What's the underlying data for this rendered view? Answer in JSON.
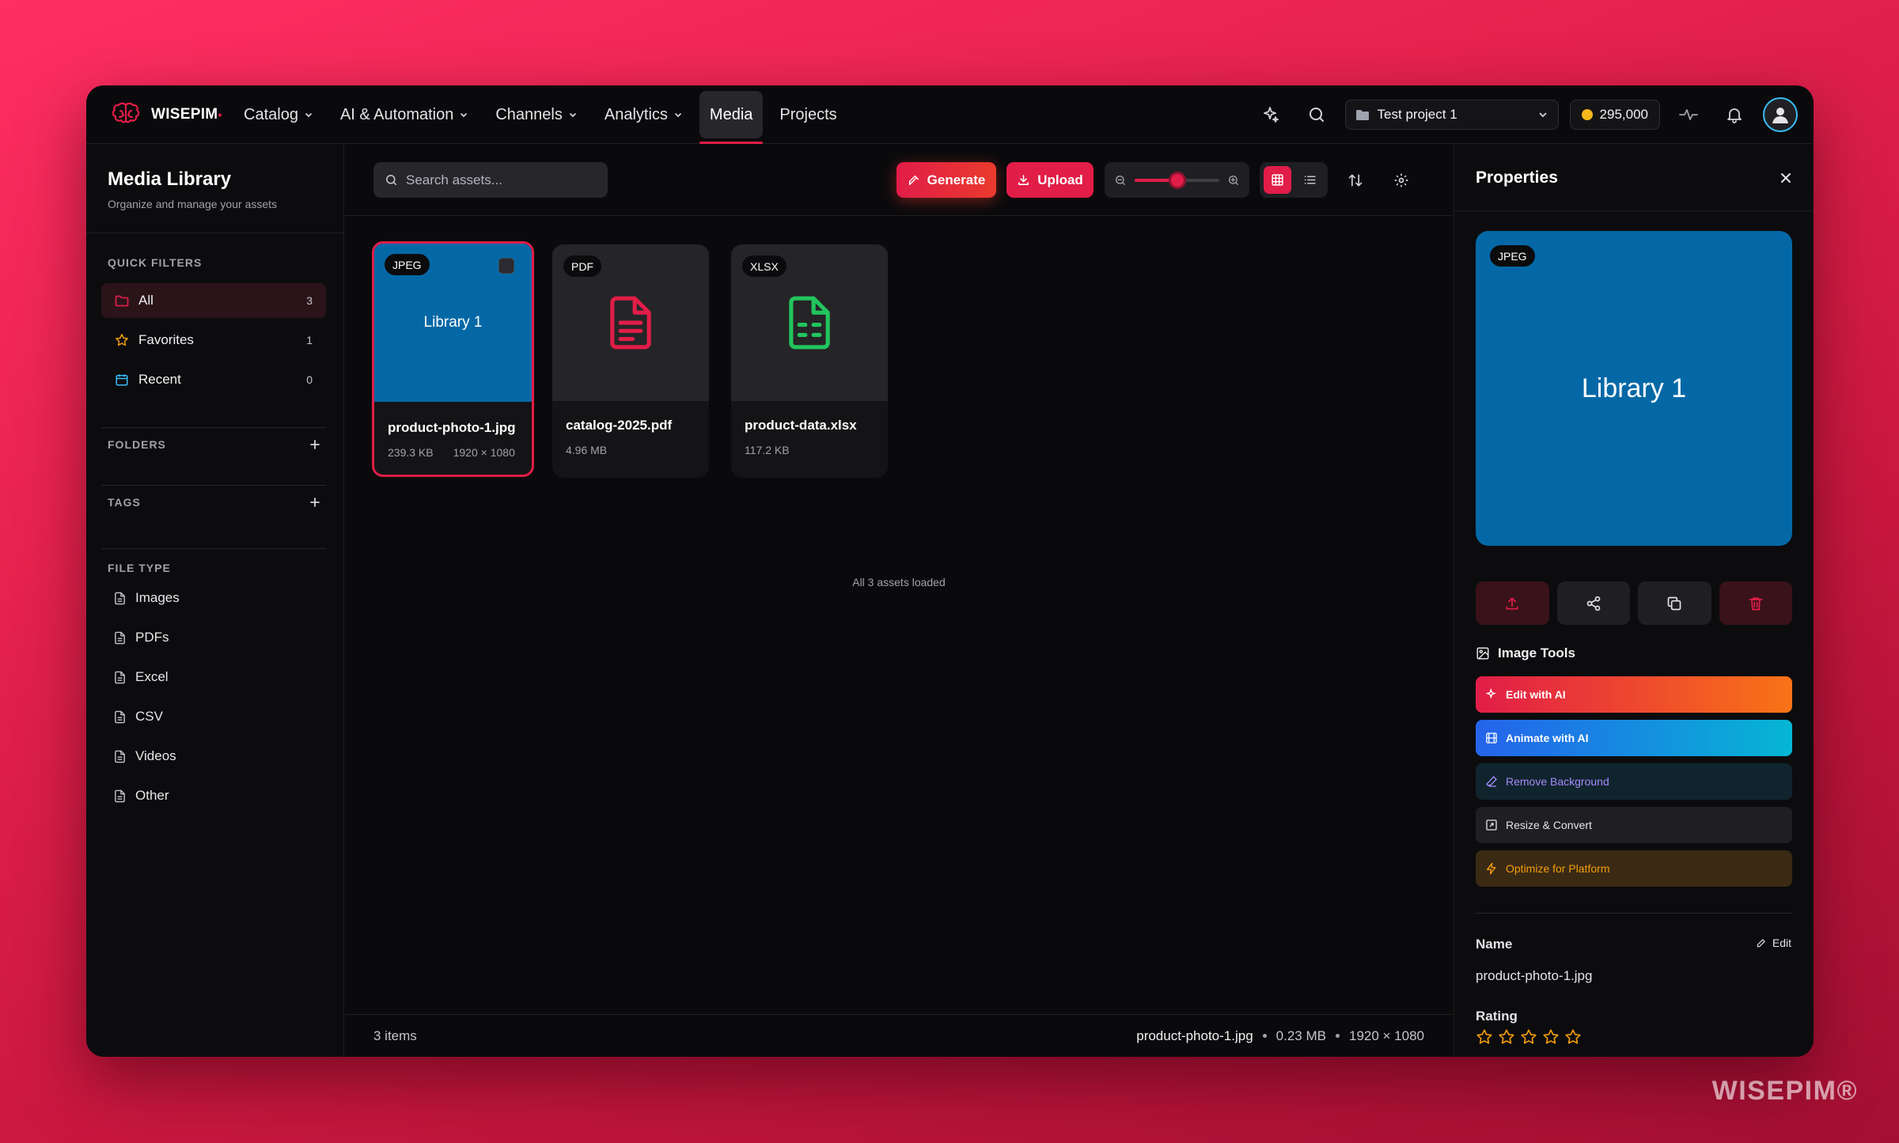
{
  "app": {
    "logo_text": "WISEPIM",
    "logo_mark": "•",
    "watermark": "WISEPIM®"
  },
  "nav": {
    "items": [
      {
        "label": "Catalog",
        "has_dropdown": true
      },
      {
        "label": "AI & Automation",
        "has_dropdown": true
      },
      {
        "label": "Channels",
        "has_dropdown": true
      },
      {
        "label": "Analytics",
        "has_dropdown": true
      },
      {
        "label": "Media",
        "active": true
      },
      {
        "label": "Projects"
      }
    ]
  },
  "topbar": {
    "project": "Test project 1",
    "credits": "295,000",
    "icons": [
      "sparkles-icon",
      "search-icon",
      "activity-icon",
      "bell-icon",
      "user-avatar"
    ]
  },
  "sidebar": {
    "title": "Media Library",
    "subtitle": "Organize and manage your assets",
    "quick_filters_label": "QUICK FILTERS",
    "quick_filters": [
      {
        "label": "All",
        "count": "3",
        "icon": "folder-icon",
        "active": true
      },
      {
        "label": "Favorites",
        "count": "1",
        "icon": "star-icon"
      },
      {
        "label": "Recent",
        "count": "0",
        "icon": "calendar-icon"
      }
    ],
    "folders_label": "FOLDERS",
    "tags_label": "TAGS",
    "file_type_label": "FILE TYPE",
    "file_types": [
      {
        "label": "Images"
      },
      {
        "label": "PDFs"
      },
      {
        "label": "Excel"
      },
      {
        "label": "CSV"
      },
      {
        "label": "Videos"
      },
      {
        "label": "Other"
      }
    ]
  },
  "toolbar": {
    "search_placeholder": "Search assets...",
    "generate_label": "Generate",
    "upload_label": "Upload",
    "zoom_level": 0.5,
    "view_mode": "grid"
  },
  "assets": [
    {
      "type_badge": "JPEG",
      "name": "product-photo-1.jpg",
      "size": "239.3 KB",
      "dimensions": "1920 × 1080",
      "thumb_text": "Library 1",
      "thumb_color": "#0568a6",
      "selected": true
    },
    {
      "type_badge": "PDF",
      "name": "catalog-2025.pdf",
      "size": "4.96 MB",
      "icon": "pdf-file-icon",
      "icon_color": "#e11d48"
    },
    {
      "type_badge": "XLSX",
      "name": "product-data.xlsx",
      "size": "117.2 KB",
      "icon": "spreadsheet-file-icon",
      "icon_color": "#22c55e"
    }
  ],
  "loaded_text": "All 3 assets loaded",
  "statusbar": {
    "count": "3 items",
    "selected_name": "product-photo-1.jpg",
    "selected_size": "0.23 MB",
    "selected_dims": "1920 × 1080"
  },
  "properties": {
    "title": "Properties",
    "preview_badge": "JPEG",
    "preview_text": "Library 1",
    "tools_label": "Image Tools",
    "tools": [
      {
        "label": "Edit with AI",
        "color": "#ffffff"
      },
      {
        "label": "Animate with AI",
        "color": "#ffffff"
      },
      {
        "label": "Remove Background",
        "color": "#a78bfa"
      },
      {
        "label": "Resize & Convert",
        "color": "#e4e4e7"
      },
      {
        "label": "Optimize for Platform",
        "color": "#f59e0b"
      }
    ],
    "name_label": "Name",
    "edit_label": "Edit",
    "name_value": "product-photo-1.jpg",
    "rating_label": "Rating",
    "rating": 0,
    "rating_max": 5
  },
  "colors": {
    "accent": "#e11d48",
    "background": "#0a0a0c",
    "star": "#f59e0b"
  }
}
